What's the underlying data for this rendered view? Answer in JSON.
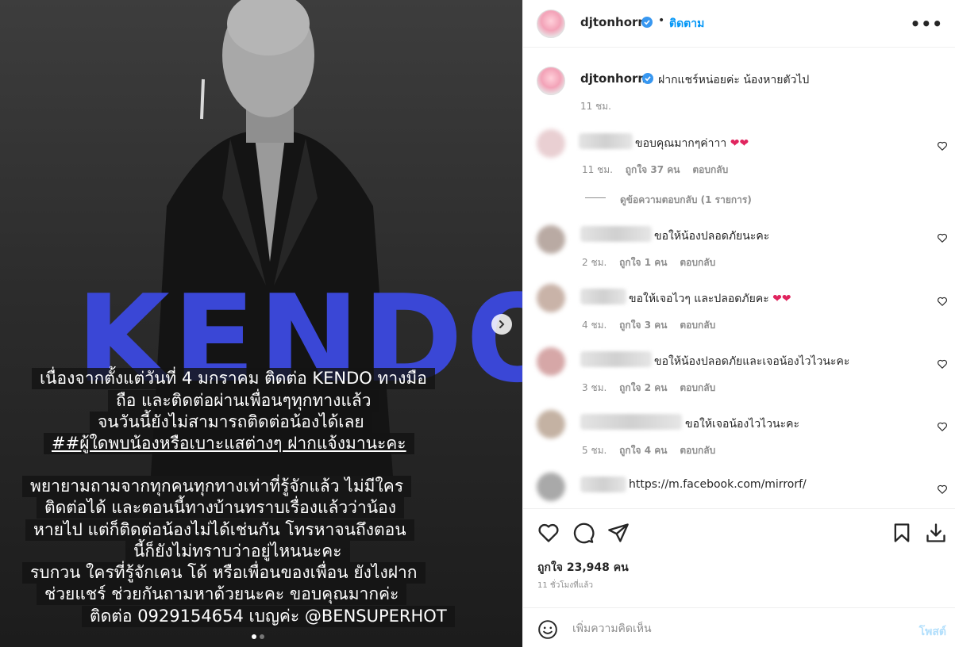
{
  "media": {
    "brand_text": "KENDO",
    "story_lines": [
      "เนื่องจากตั้งแต่วันที่ 4 มกราคม  ติดต่อ KENDO ทางมือ",
      "ถือ และติดต่อผ่านเพื่อนๆทุกทางแล้ว",
      "จนวันนี้ยังไม่สามารถติดต่อน้องได้เลย",
      "##ผู้ใดพบน้องหรือเบาะแสต่างๆ ฝากแจ้งมานะคะ",
      "พยายามถามจากทุกคนทุกทางเท่าที่รู้จักแล้ว ไม่มีใคร",
      "ติดต่อได้ และตอนนี้ทางบ้านทราบเรื่องแล้วว่าน้อง",
      "หายไป แต่ก็ติดต่อน้องไม่ได้เช่นกัน โทรหาจนถึงตอน",
      "นี้ก็ยังไม่ทราบว่าอยู่ไหนนะคะ",
      "รบกวน ใครที่รู้จักเคน โด้ หรือเพื่อนของเพื่อน ยังไงฝาก",
      "ช่วยแชร์ ช่วยกันถามหาด้วยนะคะ ขอบคุณมากค่ะ",
      "ติดต่อ 0929154654 เบญค่ะ @BENSUPERHOT"
    ]
  },
  "header": {
    "username": "djtonhorm",
    "separator": "•",
    "follow_label": "ติดตาม",
    "more_label": "•••"
  },
  "caption": {
    "username": "djtonhorm",
    "text": "ฝากแชร์หน่อยค่ะ น้องหายตัวไป",
    "time": "11 ชม."
  },
  "comments": [
    {
      "text": "ขอบคุณมากๆค่าาา",
      "hearts": 2,
      "time": "11 ชม.",
      "likes": "ถูกใจ 37 คน",
      "reply": "ตอบกลับ",
      "view_replies": "ดูข้อความตอบกลับ (1 รายการ)"
    },
    {
      "text": "ขอให้น้องปลอดภัยนะคะ",
      "hearts": 0,
      "time": "2 ชม.",
      "likes": "ถูกใจ 1 คน",
      "reply": "ตอบกลับ"
    },
    {
      "text": "ขอให้เจอไวๆ และปลอดภัยคะ",
      "hearts": 2,
      "time": "4 ชม.",
      "likes": "ถูกใจ 3 คน",
      "reply": "ตอบกลับ"
    },
    {
      "text": "ขอให้น้องปลอดภัยและเจอน้องไวไวนะคะ",
      "hearts": 0,
      "time": "3 ชม.",
      "likes": "ถูกใจ 2 คน",
      "reply": "ตอบกลับ"
    },
    {
      "text": "ขอให้เจอน้องไวไวนะคะ",
      "hearts": 0,
      "time": "5 ชม.",
      "likes": "ถูกใจ 4 คน",
      "reply": "ตอบกลับ"
    },
    {
      "text": "https://m.facebook.com/mirrorf/",
      "hearts": 0
    }
  ],
  "footer": {
    "likes_label": "ถูกใจ 23,948 คน",
    "post_time": "11 ชั่วโมงที่แล้ว",
    "comment_placeholder": "เพิ่มความคิดเห็น",
    "post_label": "โพสต์"
  },
  "colors": {
    "accent": "#0095f6",
    "verified": "#3897f0",
    "heart_emoji": "#e0245e",
    "brand_text": "#3a47d6"
  }
}
